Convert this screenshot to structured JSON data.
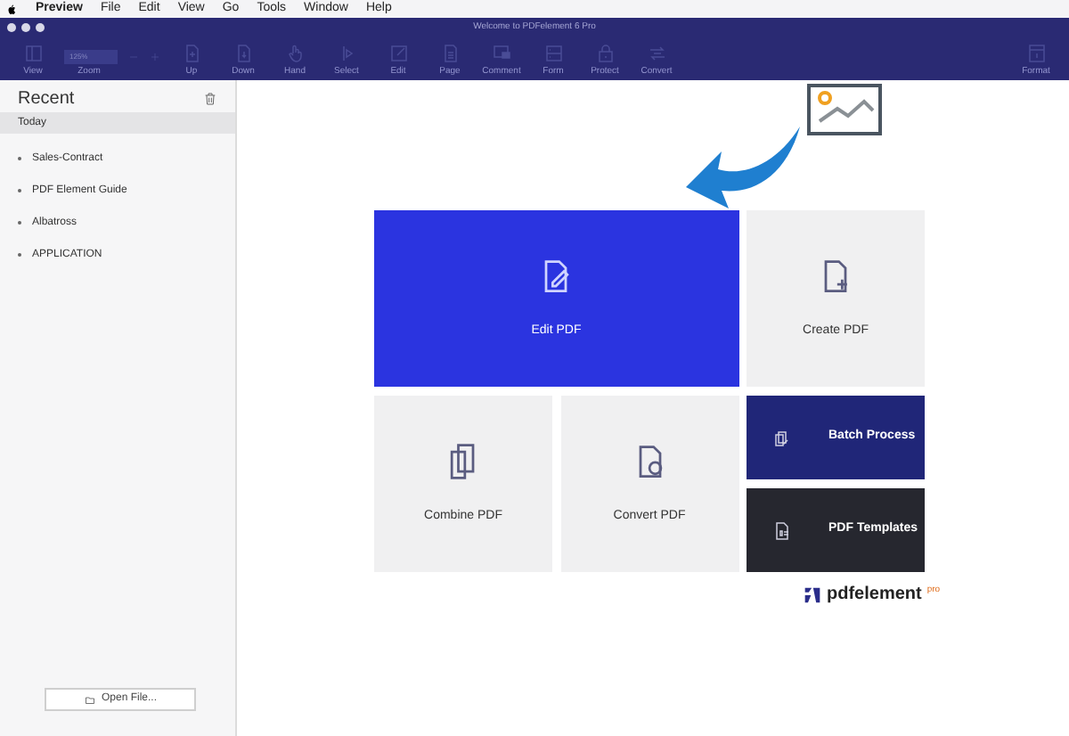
{
  "menu_bar": {
    "app": "Preview",
    "items": [
      "File",
      "Edit",
      "View",
      "Go",
      "Tools",
      "Window",
      "Help"
    ]
  },
  "window": {
    "title": "Welcome to PDFelement 6 Pro"
  },
  "toolbar": {
    "zoom_value": "125%",
    "items": [
      {
        "label": "View",
        "kind": "button"
      },
      {
        "label": "Zoom",
        "kind": "zoom"
      },
      {
        "label": "Up",
        "kind": "button"
      },
      {
        "label": "Down",
        "kind": "button"
      },
      {
        "label": "Hand",
        "kind": "button"
      },
      {
        "label": "Select",
        "kind": "button"
      },
      {
        "label": "Edit",
        "kind": "button"
      },
      {
        "label": "Page",
        "kind": "button"
      },
      {
        "label": "Comment",
        "kind": "button"
      },
      {
        "label": "Form",
        "kind": "button"
      },
      {
        "label": "Protect",
        "kind": "button"
      },
      {
        "label": "Convert",
        "kind": "button"
      },
      {
        "label": "Format",
        "kind": "end"
      }
    ]
  },
  "sidebar": {
    "title": "Recent",
    "section": "Today",
    "items": [
      "Sales-Contract",
      "PDF Element Guide",
      "Albatross",
      "APPLICATION"
    ],
    "open_button": "Open File..."
  },
  "tiles": [
    {
      "label": "Edit PDF",
      "kind": "primary"
    },
    {
      "label": "Create PDF",
      "kind": "light"
    },
    {
      "label": "Combine PDF",
      "kind": "light"
    },
    {
      "label": "Convert PDF",
      "kind": "light"
    },
    {
      "label": "Batch Process",
      "kind": "navy"
    },
    {
      "label": "PDF Templates",
      "kind": "dark"
    }
  ],
  "logo": {
    "name": "pdfelement",
    "badge": "pro"
  }
}
